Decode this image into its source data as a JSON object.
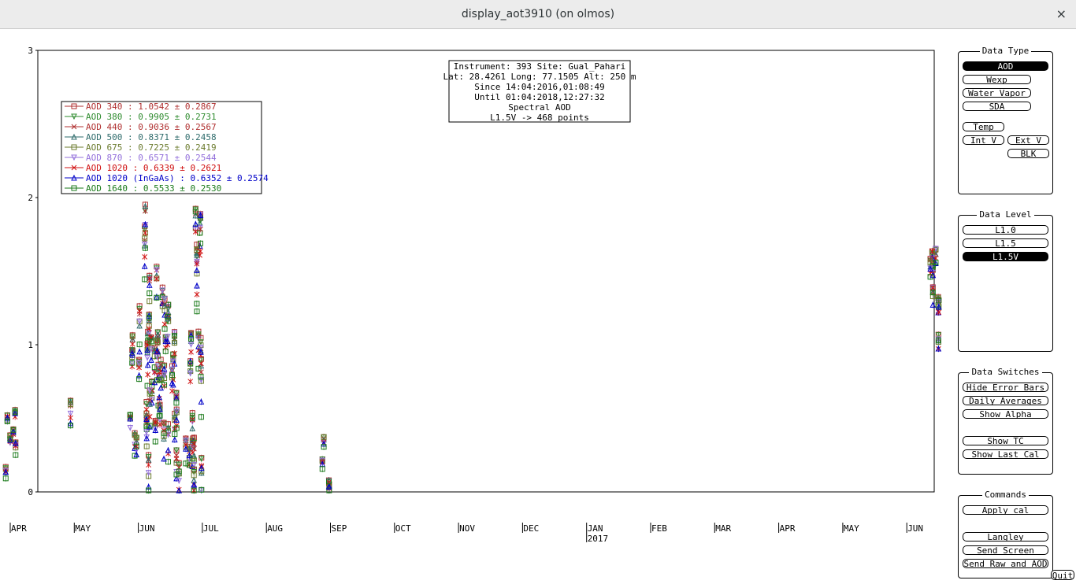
{
  "window": {
    "title": "display_aot3910 (on olmos)",
    "close_glyph": "×"
  },
  "info_box": {
    "lines": [
      "Instrument: 393 Site: Gual_Pahari",
      "Lat: 28.4261 Long: 77.1505 Alt: 250 m",
      "Since 14:04:2016,01:08:49",
      "Until 01:04:2018,12:27:32",
      "Spectral AOD",
      "L1.5V -> 468 points"
    ]
  },
  "legend": [
    {
      "text": "AOD 340  : 1.0542 ± 0.2867",
      "color": "#b03030",
      "marker": "square"
    },
    {
      "text": "AOD 380  : 0.9905 ± 0.2731",
      "color": "#2e8b2e",
      "marker": "tri-down"
    },
    {
      "text": "AOD 440  : 0.9036 ± 0.2567",
      "color": "#b03030",
      "marker": "x"
    },
    {
      "text": "AOD 500  : 0.8371 ± 0.2458",
      "color": "#2e6b6b",
      "marker": "tri-up"
    },
    {
      "text": "AOD 675  : 0.7225 ± 0.2419",
      "color": "#6b7b2e",
      "marker": "square"
    },
    {
      "text": "AOD 870  : 0.6571 ± 0.2544",
      "color": "#9370db",
      "marker": "tri-down"
    },
    {
      "text": "AOD 1020  : 0.6339 ± 0.2621",
      "color": "#d01010",
      "marker": "x"
    },
    {
      "text": "AOD 1020 (InGaAs)  : 0.6352 ± 0.2574",
      "color": "#0000c8",
      "marker": "tri-up"
    },
    {
      "text": "AOD 1640  : 0.5533 ± 0.2530",
      "color": "#1a7a1a",
      "marker": "square"
    }
  ],
  "chart_data": {
    "type": "scatter",
    "ylim": [
      0,
      3
    ],
    "yticks": [
      "0",
      "1",
      "2",
      "3"
    ],
    "x_months": [
      "APR",
      "MAY",
      "JUN",
      "JUL",
      "AUG",
      "SEP",
      "OCT",
      "NOV",
      "DEC",
      "JAN",
      "FEB",
      "MAR",
      "APR",
      "MAY",
      "JUN"
    ],
    "x_year_label": "2017",
    "x_year_month_index": 9,
    "clusters": [
      {
        "month": 0.0,
        "lo": 0.15,
        "hi": 0.57,
        "dense": 6
      },
      {
        "month": 0.95,
        "lo": 0.26,
        "hi": 1.08,
        "dense": 1
      },
      {
        "month": 1.95,
        "lo": 0.3,
        "hi": 1.1,
        "dense": 6
      },
      {
        "month": 2.1,
        "lo": 0.2,
        "hi": 1.97,
        "dense": 10
      },
      {
        "month": 2.25,
        "lo": 0.3,
        "hi": 1.58,
        "dense": 10
      },
      {
        "month": 2.42,
        "lo": 0.35,
        "hi": 1.68,
        "dense": 10
      },
      {
        "month": 2.6,
        "lo": 0.18,
        "hi": 1.3,
        "dense": 8
      },
      {
        "month": 2.8,
        "lo": 0.25,
        "hi": 1.1,
        "dense": 5
      },
      {
        "month": 2.93,
        "lo": 0.1,
        "hi": 2.02,
        "dense": 12
      },
      {
        "month": 4.9,
        "lo": 0.05,
        "hi": 0.38,
        "dense": 4
      },
      {
        "month": 14.45,
        "lo": 1.0,
        "hi": 1.66,
        "dense": 8
      }
    ]
  },
  "panels": {
    "data_type": {
      "title": "Data Type",
      "buttons": [
        {
          "label": "AOD",
          "active": true
        },
        {
          "label": "Wexp",
          "active": false
        },
        {
          "label": "Water Vapor",
          "active": false
        },
        {
          "label": "SDA",
          "active": false
        },
        {
          "label": "Temp",
          "active": false
        },
        {
          "label": "Int V",
          "active": false
        },
        {
          "label": "Ext V",
          "active": false
        },
        {
          "label": "BLK",
          "active": false
        }
      ]
    },
    "data_level": {
      "title": "Data Level",
      "buttons": [
        {
          "label": "L1.0",
          "active": false
        },
        {
          "label": "L1.5",
          "active": false
        },
        {
          "label": "L1.5V",
          "active": true
        }
      ]
    },
    "data_switches": {
      "title": "Data Switches",
      "buttons": [
        {
          "label": "Hide Error Bars"
        },
        {
          "label": "Daily Averages"
        },
        {
          "label": "Show Alpha"
        },
        {
          "label": "Show TC"
        },
        {
          "label": "Show Last Cal"
        }
      ]
    },
    "commands": {
      "title": "Commands",
      "buttons": [
        {
          "label": "Apply cal"
        },
        {
          "label": "Langley"
        },
        {
          "label": "Send Screen"
        },
        {
          "label": "Send Raw and AOD"
        }
      ]
    }
  },
  "quit_label": "Quit"
}
